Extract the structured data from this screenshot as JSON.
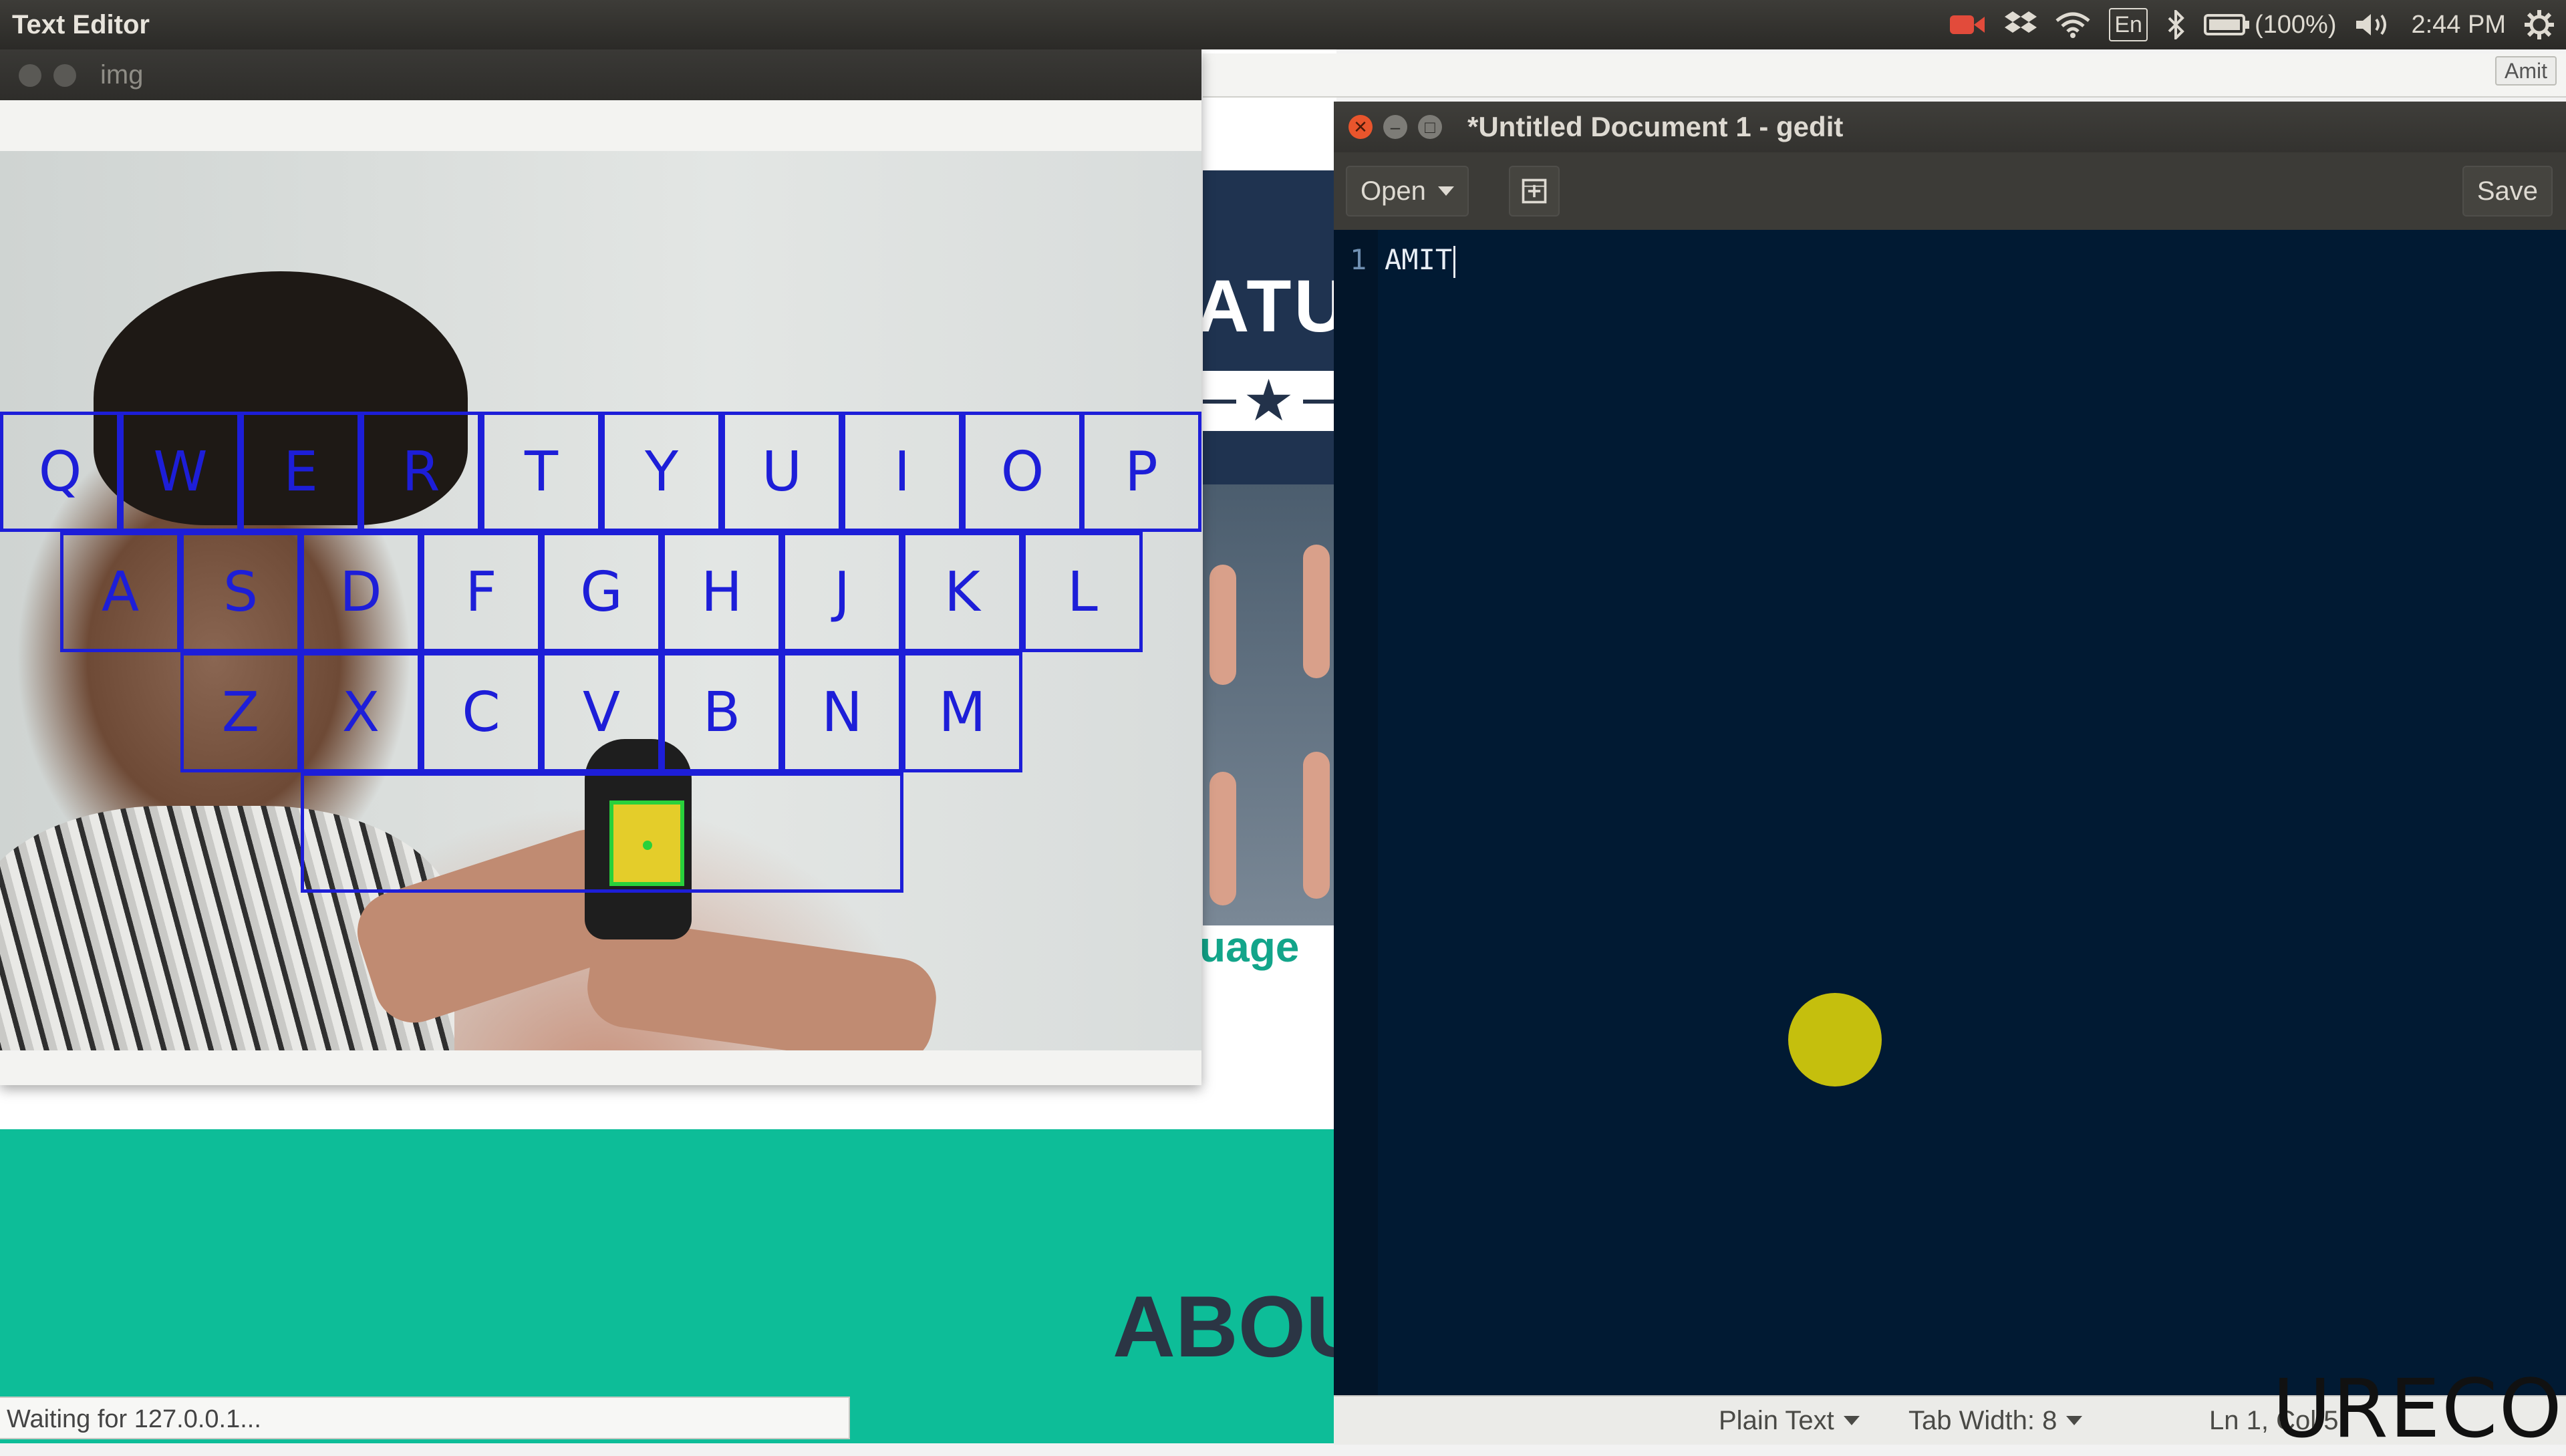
{
  "topbar": {
    "app_title": "Text Editor",
    "battery": "(100%)",
    "keyboard_layout": "En",
    "time": "2:44 PM",
    "icons": [
      "record-icon",
      "dropbox-icon",
      "wifi-icon",
      "keyboard-layout-icon",
      "bluetooth-icon",
      "battery-icon",
      "volume-icon",
      "power-gear-icon"
    ]
  },
  "browser": {
    "user_chip": "Amit",
    "heading_fragment": "ATU",
    "lang_fragment": "uage",
    "about_fragment": "ABOU",
    "status": "Waiting for 127.0.0.1..."
  },
  "img_window": {
    "title": "img",
    "keyboard_rows": [
      [
        "Q",
        "W",
        "E",
        "R",
        "T",
        "Y",
        "U",
        "I",
        "O",
        "P"
      ],
      [
        "A",
        "S",
        "D",
        "F",
        "G",
        "H",
        "J",
        "K",
        "L"
      ],
      [
        "Z",
        "X",
        "C",
        "V",
        "B",
        "N",
        "M"
      ]
    ],
    "colors": {
      "key_outline": "#1d1ed8",
      "marker_outline": "#29d13b",
      "marker_fill": "#e4cd2a"
    }
  },
  "gedit": {
    "title": "*Untitled Document 1 - gedit",
    "open_label": "Open",
    "save_label": "Save",
    "line_number": "1",
    "line_text": "AMIT",
    "status": {
      "syntax": "Plain Text",
      "tab_width": "Tab Width: 8",
      "position": "Ln 1, Col 5"
    },
    "colors": {
      "editor_bg": "#011a33",
      "cursor_dot": "#c5bf0d"
    }
  },
  "watermark": "URECO"
}
